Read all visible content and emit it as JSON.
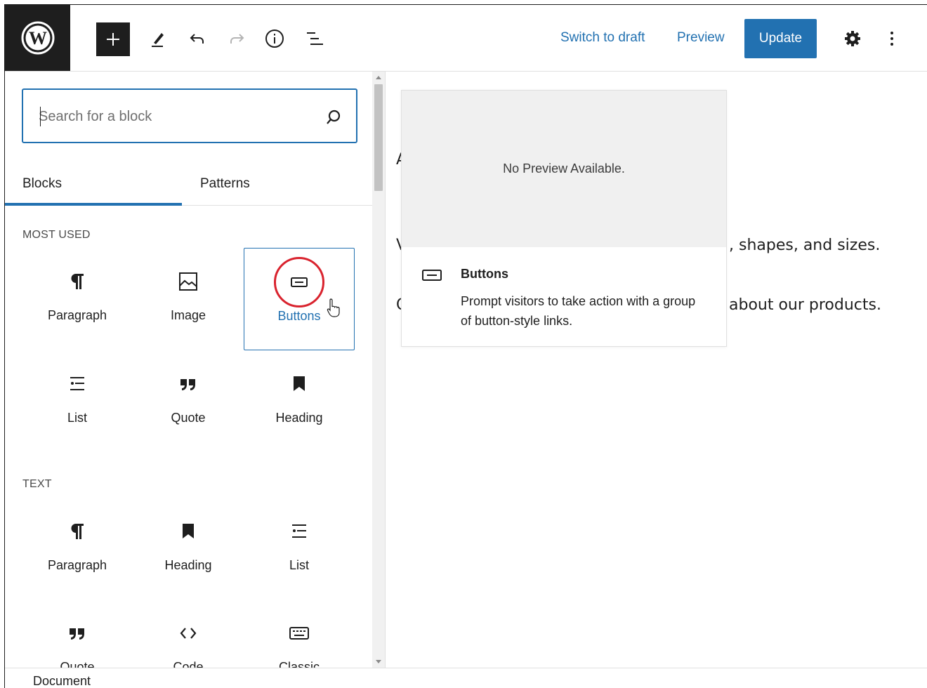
{
  "topbar": {
    "logo": "wordpress-logo",
    "tools": [
      "add-block",
      "edit-tools",
      "undo",
      "redo",
      "details",
      "document-overview"
    ],
    "switch_to_draft": "Switch to draft",
    "preview": "Preview",
    "update": "Update",
    "settings_icon": "gear-icon",
    "more_icon": "kebab-menu-icon"
  },
  "sidebar": {
    "search_placeholder": "Search for a block",
    "tabs": [
      {
        "label": "Blocks",
        "active": true
      },
      {
        "label": "Patterns",
        "active": false
      }
    ],
    "most_used": {
      "label": "MOST USED",
      "items": [
        {
          "label": "Paragraph",
          "icon": "paragraph-icon"
        },
        {
          "label": "Image",
          "icon": "image-icon"
        },
        {
          "label": "Buttons",
          "icon": "buttons-icon",
          "selected": true,
          "highlighted": true
        },
        {
          "label": "List",
          "icon": "list-icon"
        },
        {
          "label": "Quote",
          "icon": "quote-icon"
        },
        {
          "label": "Heading",
          "icon": "heading-icon"
        }
      ]
    },
    "text": {
      "label": "TEXT",
      "items": [
        {
          "label": "Paragraph",
          "icon": "paragraph-icon"
        },
        {
          "label": "Heading",
          "icon": "heading-icon"
        },
        {
          "label": "List",
          "icon": "list-icon"
        },
        {
          "label": "Quote",
          "icon": "quote-icon"
        },
        {
          "label": "Code",
          "icon": "code-icon"
        },
        {
          "label": "Classic",
          "icon": "keyboard-icon"
        }
      ]
    }
  },
  "preview_popover": {
    "no_preview": "No Preview Available.",
    "title": "Buttons",
    "description": "Prompt visitors to take action with a group of button-style links."
  },
  "editor": {
    "line1_fragment_left": "A",
    "line2_fragment_left": "V",
    "line2_fragment_right": ", shapes, and sizes.",
    "line3_fragment_left": "C",
    "line3_fragment_right": "about our products."
  },
  "footer": {
    "label": "Document"
  },
  "colors": {
    "accent": "#2271b1",
    "dark": "#1e1e1e",
    "highlight_circle": "#d9232e"
  }
}
